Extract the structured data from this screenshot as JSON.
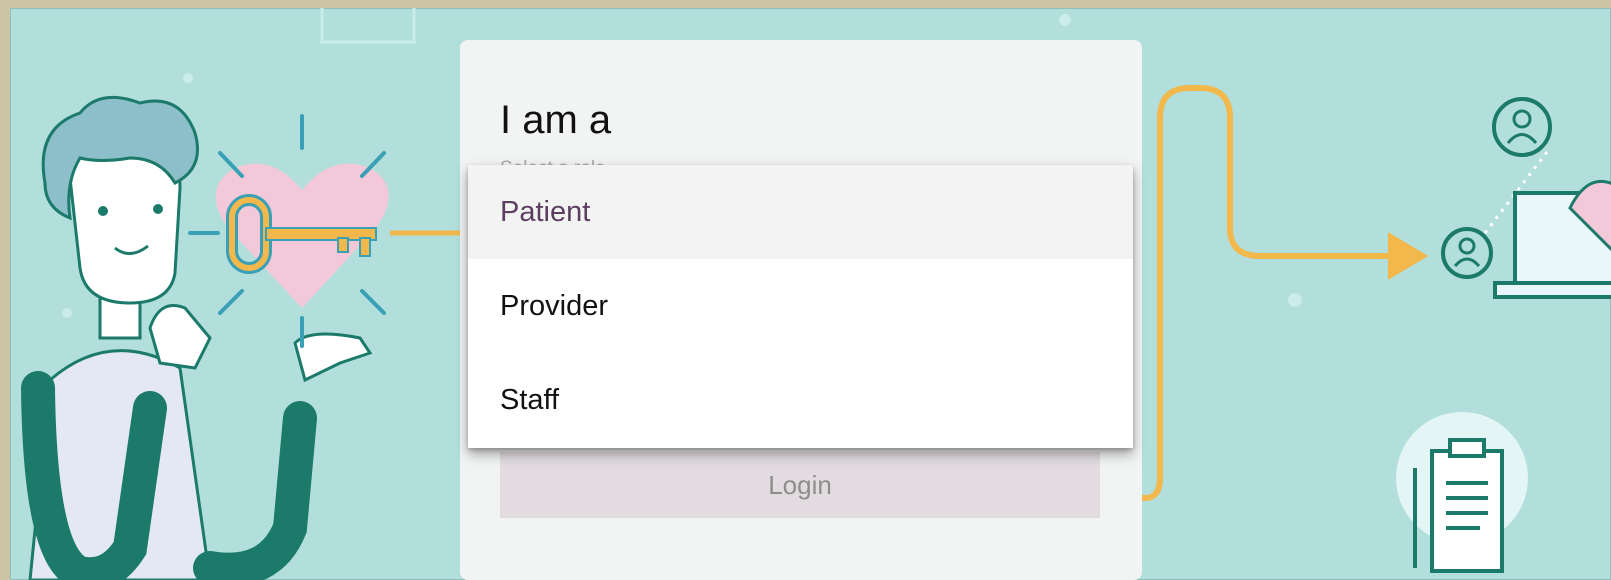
{
  "card": {
    "title": "I am a",
    "hint": "Select a role",
    "login_label": "Login"
  },
  "role_menu": {
    "options": [
      {
        "label": "Patient",
        "selected": true
      },
      {
        "label": "Provider",
        "selected": false
      },
      {
        "label": "Staff",
        "selected": false
      }
    ]
  },
  "colors": {
    "background": "#b2dfdc",
    "accent_orange": "#f2b84b",
    "illustration_green": "#1c7a6a",
    "heart_pink": "#f3c9d9",
    "selected_text": "#5b3e60"
  }
}
